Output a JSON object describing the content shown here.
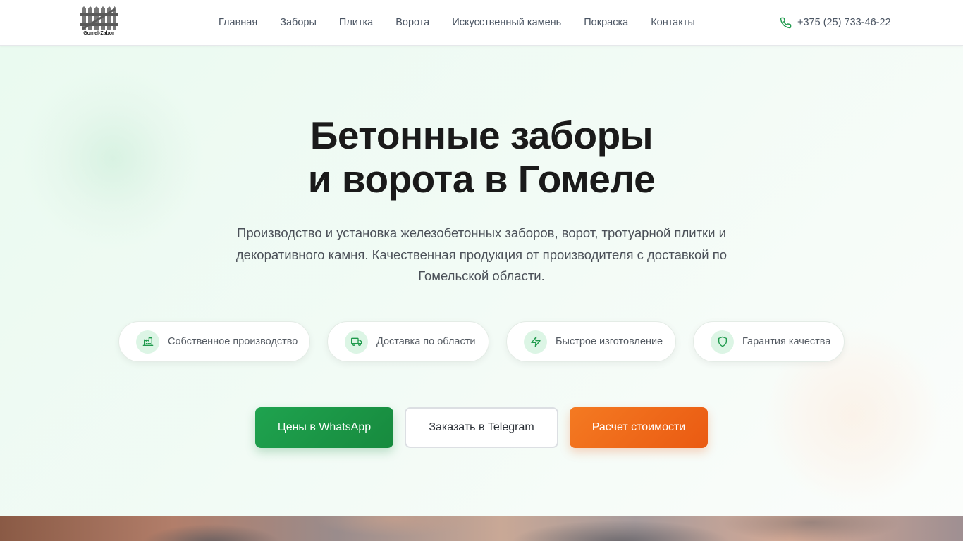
{
  "header": {
    "logo_text": "Gomel-Zabor",
    "nav": [
      {
        "label": "Главная"
      },
      {
        "label": "Заборы"
      },
      {
        "label": "Плитка"
      },
      {
        "label": "Ворота"
      },
      {
        "label": "Искусственный камень"
      },
      {
        "label": "Покраска"
      },
      {
        "label": "Контакты"
      }
    ],
    "phone": "+375 (25) 733-46-22"
  },
  "hero": {
    "title_line1": "Бетонные заборы",
    "title_line2": "и ворота в Гомеле",
    "subtitle": "Производство и установка железобетонных заборов, ворот, тротуарной плитки и декоративного камня. Качественная продукция от производителя с доставкой по Гомельской области.",
    "features": [
      {
        "label": "Собственное производство",
        "icon": "factory-icon"
      },
      {
        "label": "Доставка по области",
        "icon": "truck-icon"
      },
      {
        "label": "Быстрое изготовление",
        "icon": "lightning-icon"
      },
      {
        "label": "Гарантия качества",
        "icon": "shield-icon"
      }
    ],
    "buttons": {
      "whatsapp": "Цены в WhatsApp",
      "telegram": "Заказать в Telegram",
      "calc": "Расчет стоимости"
    }
  },
  "colors": {
    "accent_green": "#1fa34f",
    "accent_orange": "#f47a22",
    "icon_bg": "#dcf5e5"
  }
}
